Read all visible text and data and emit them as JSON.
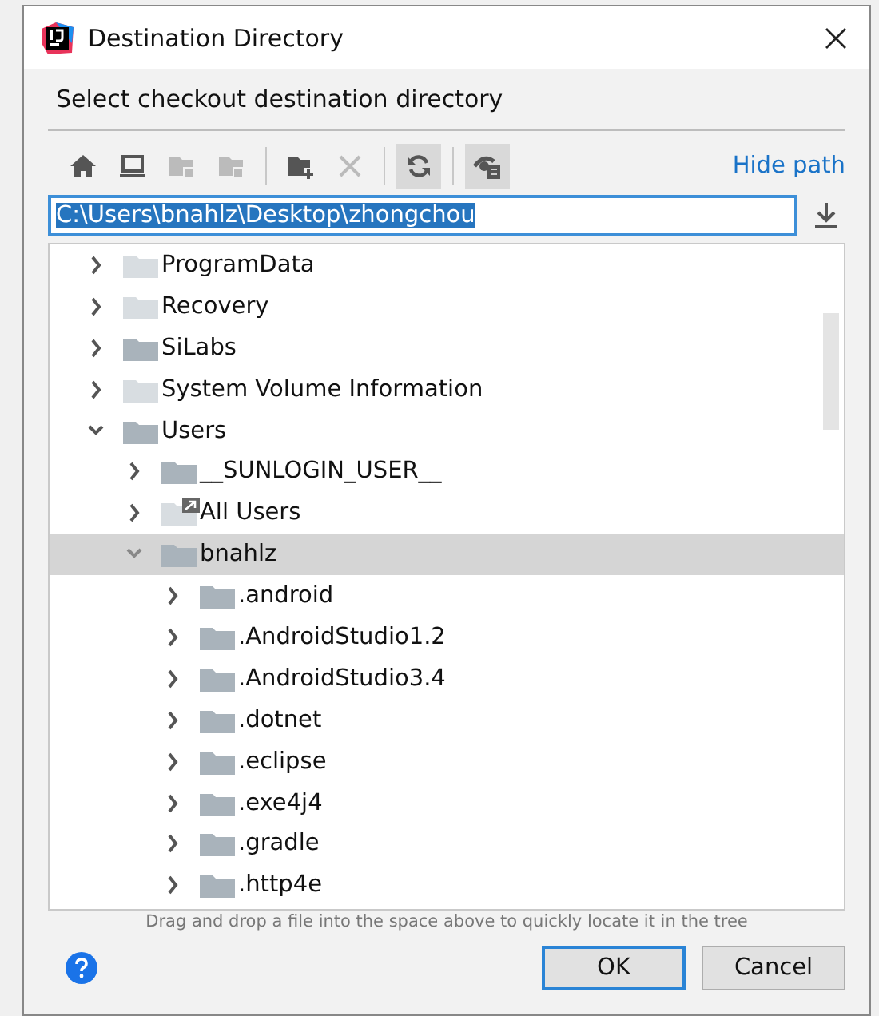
{
  "window": {
    "title": "Destination Directory"
  },
  "description": "Select checkout destination directory",
  "toolbar": [
    {
      "kind": "home",
      "disabled": false,
      "pressed": false
    },
    {
      "kind": "desktop",
      "disabled": false,
      "pressed": false
    },
    {
      "kind": "project",
      "disabled": true,
      "pressed": false
    },
    {
      "kind": "module",
      "disabled": true,
      "pressed": false
    },
    {
      "kind": "separator"
    },
    {
      "kind": "new-folder",
      "disabled": false,
      "pressed": false
    },
    {
      "kind": "delete",
      "disabled": true,
      "pressed": false
    },
    {
      "kind": "separator"
    },
    {
      "kind": "refresh",
      "disabled": false,
      "pressed": true
    },
    {
      "kind": "separator"
    },
    {
      "kind": "show-hidden",
      "disabled": false,
      "pressed": true
    }
  ],
  "hide_path_link": "Hide path",
  "path_field": {
    "value": "C:\\Users\\bnahlz\\Desktop\\zhongchou",
    "text_selected": true
  },
  "tree": [
    {
      "name": "ProgramData",
      "kind": "hidden",
      "expanded": false,
      "selected": false
    },
    {
      "name": "Recovery",
      "kind": "hidden",
      "expanded": false,
      "selected": false
    },
    {
      "name": "SiLabs",
      "kind": "normal",
      "expanded": false,
      "selected": false
    },
    {
      "name": "System Volume Information",
      "kind": "hidden",
      "expanded": false,
      "selected": false
    },
    {
      "name": "Users",
      "kind": "normal",
      "expanded": true,
      "selected": false,
      "children": [
        {
          "name": "__SUNLOGIN_USER__",
          "kind": "normal",
          "expanded": false,
          "selected": false
        },
        {
          "name": "All Users",
          "kind": "link",
          "expanded": false,
          "selected": false
        },
        {
          "name": "bnahlz",
          "kind": "normal",
          "expanded": true,
          "selected": true,
          "children": [
            {
              "name": ".android",
              "kind": "normal",
              "expanded": false,
              "selected": false
            },
            {
              "name": ".AndroidStudio1.2",
              "kind": "normal",
              "expanded": false,
              "selected": false
            },
            {
              "name": ".AndroidStudio3.4",
              "kind": "normal",
              "expanded": false,
              "selected": false
            },
            {
              "name": ".dotnet",
              "kind": "normal",
              "expanded": false,
              "selected": false
            },
            {
              "name": ".eclipse",
              "kind": "normal",
              "expanded": false,
              "selected": false
            },
            {
              "name": ".exe4j4",
              "kind": "normal",
              "expanded": false,
              "selected": false
            },
            {
              "name": ".gradle",
              "kind": "normal",
              "expanded": false,
              "selected": false
            },
            {
              "name": ".http4e",
              "kind": "normal",
              "expanded": false,
              "selected": false
            }
          ]
        }
      ]
    }
  ],
  "hint": "Drag and drop a file into the space above to quickly locate it in the tree",
  "buttons": [
    {
      "label": "OK",
      "default": true
    },
    {
      "label": "Cancel",
      "default": false
    }
  ]
}
